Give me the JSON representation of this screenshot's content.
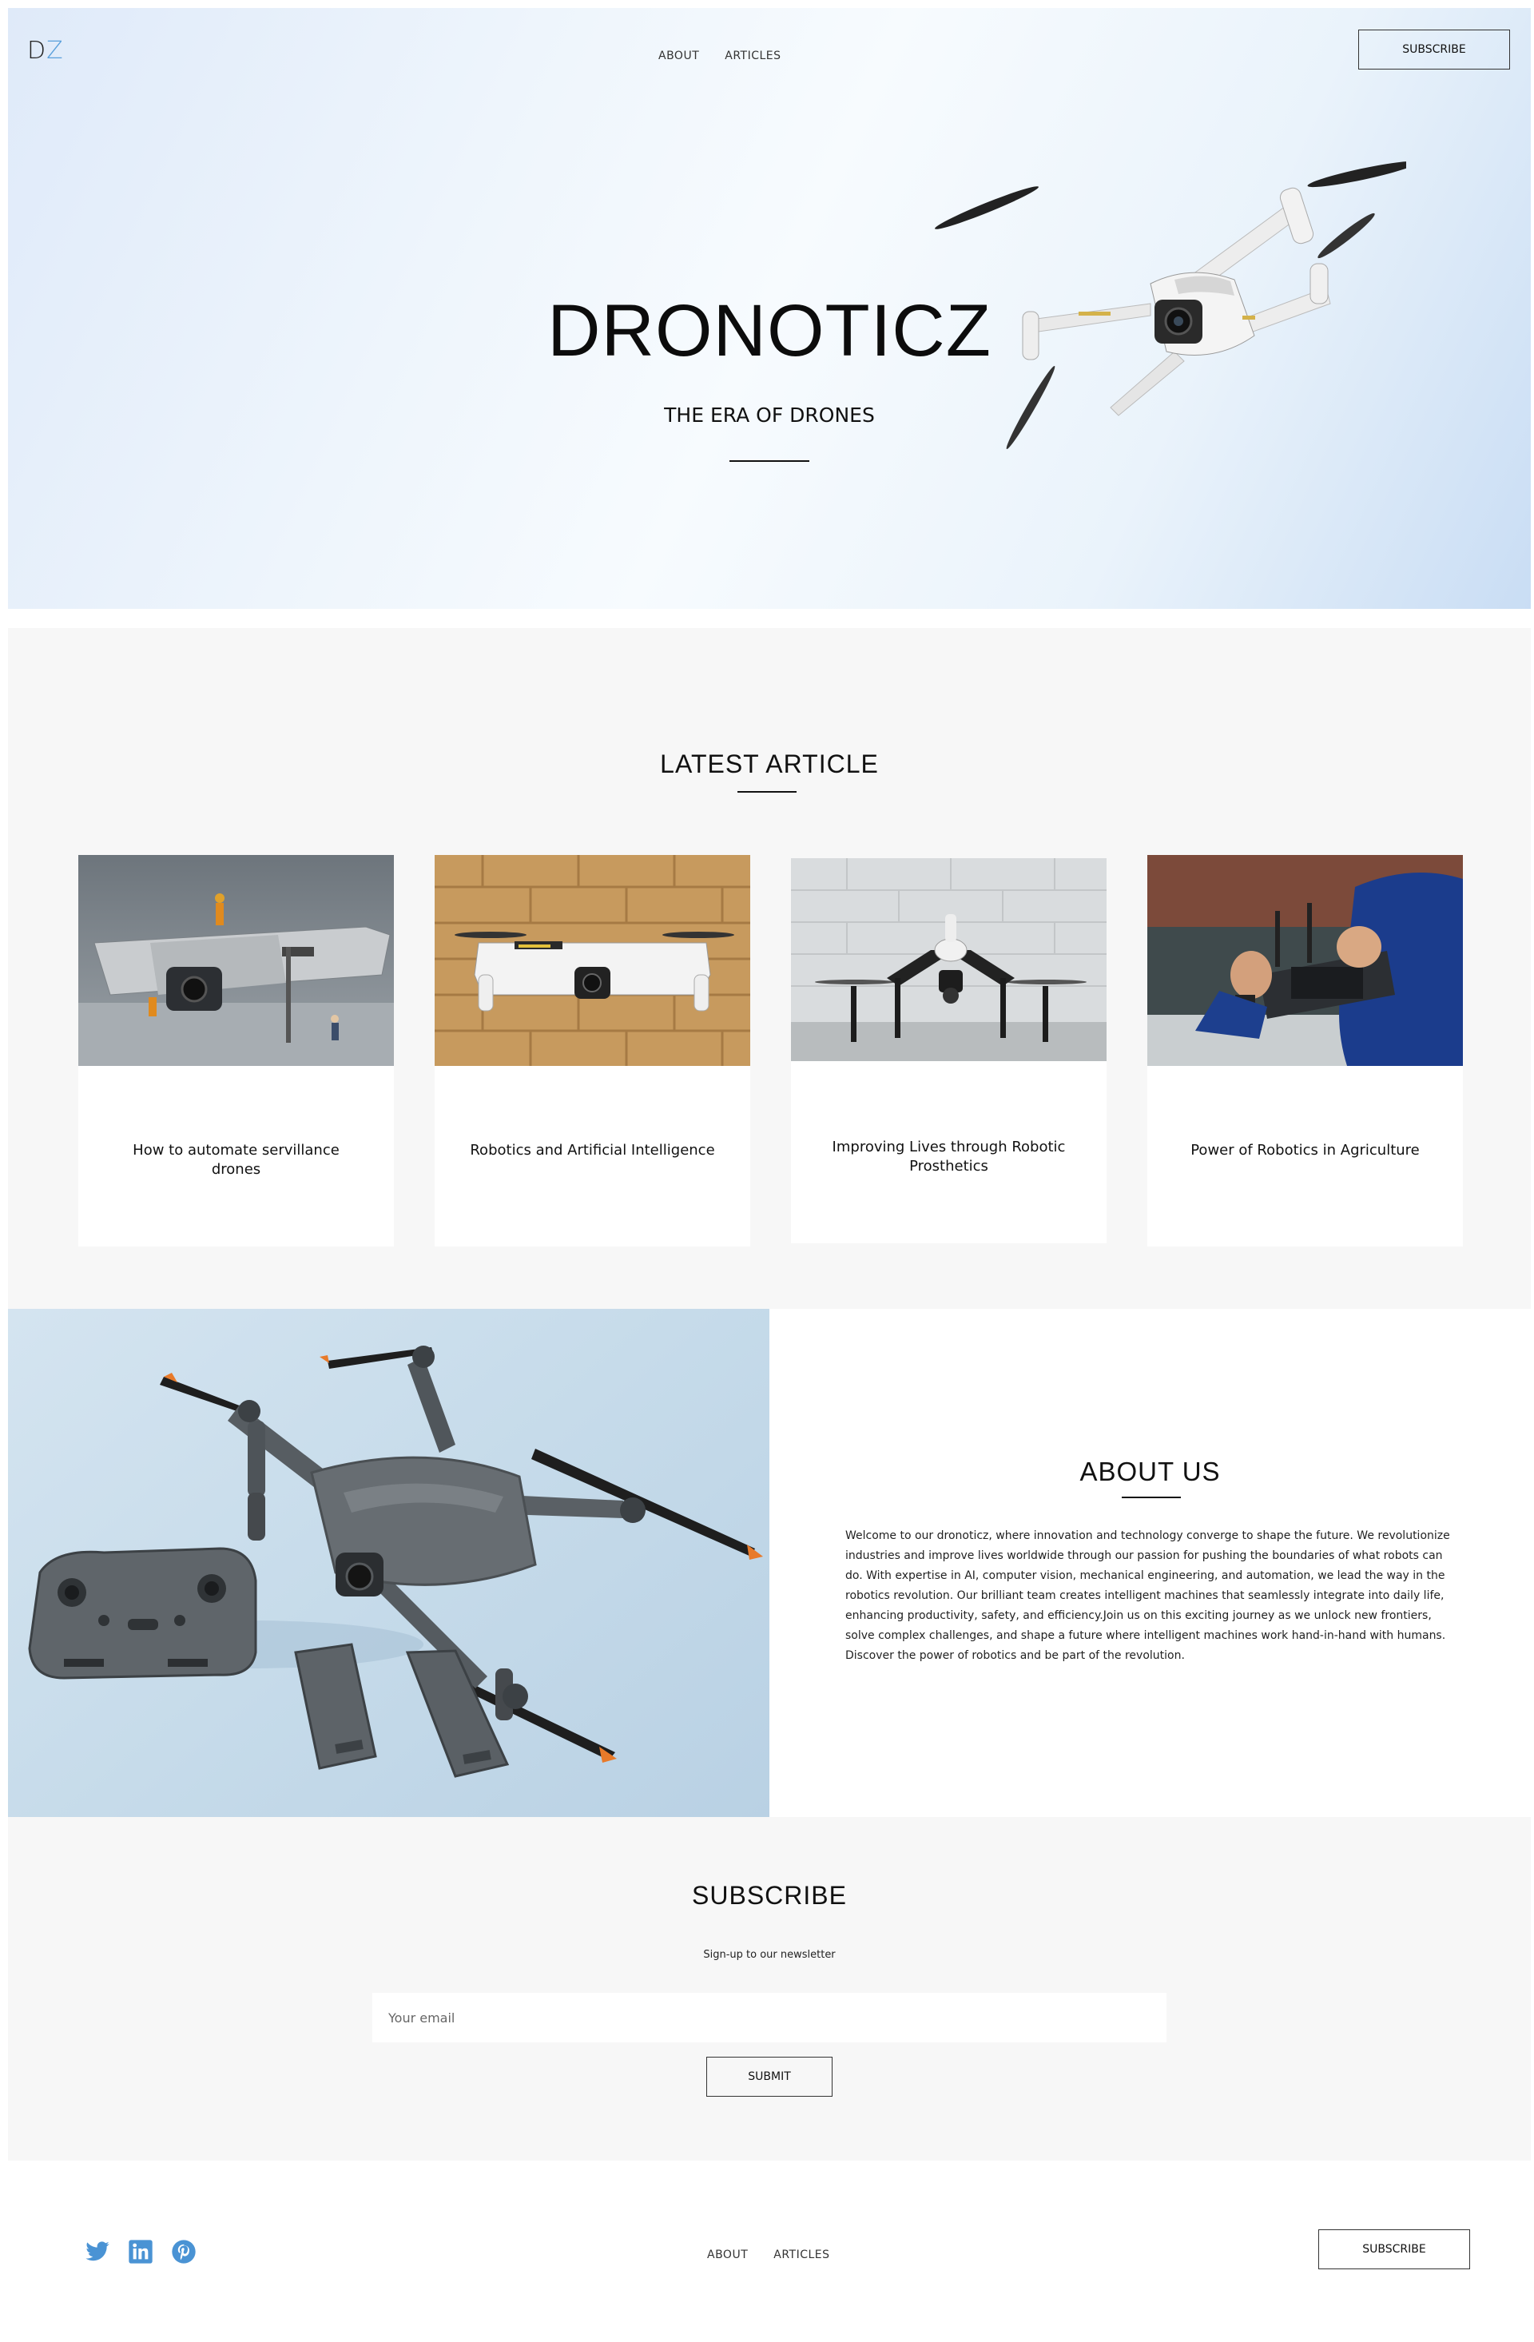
{
  "header": {
    "logo_d": "D",
    "logo_z": "Z",
    "nav": [
      "ABOUT",
      "ARTICLES"
    ],
    "subscribe_label": "SUBSCRIBE"
  },
  "hero": {
    "title": "DRONOTICZ",
    "subtitle": "THE ERA OF DRONES"
  },
  "latest": {
    "title": "LATEST ARTICLE",
    "articles": [
      {
        "title": "How to automate servillance drones"
      },
      {
        "title": "Robotics and Artificial Intelligence"
      },
      {
        "title": "Improving Lives through Robotic Prosthetics"
      },
      {
        "title": "Power of Robotics in Agriculture"
      }
    ]
  },
  "about": {
    "title": "ABOUT US",
    "body": "Welcome to our dronoticz, where innovation and technology converge to shape the future. We revolutionize industries and improve lives worldwide through our passion for pushing the boundaries of what robots can do. With expertise in AI, computer vision, mechanical engineering, and automation, we lead the way in the robotics revolution. Our brilliant team creates intelligent machines that seamlessly integrate into daily life, enhancing productivity, safety, and efficiency.Join us on this exciting journey as we unlock new frontiers, solve complex challenges, and shape a future where intelligent machines work hand-in-hand with humans. Discover the power of robotics and be part of the revolution."
  },
  "subscribe": {
    "title": "SUBSCRIBE",
    "note": "Sign-up to our newsletter",
    "placeholder": "Your email",
    "submit_label": "SUBMIT"
  },
  "footer": {
    "nav": [
      "ABOUT",
      "ARTICLES"
    ],
    "subscribe_label": "SUBSCRIBE",
    "social_icons": [
      "twitter-icon",
      "linkedin-icon",
      "pinterest-icon"
    ]
  },
  "colors": {
    "accent": "#5aa0db",
    "section_bg": "#f7f7f7"
  }
}
